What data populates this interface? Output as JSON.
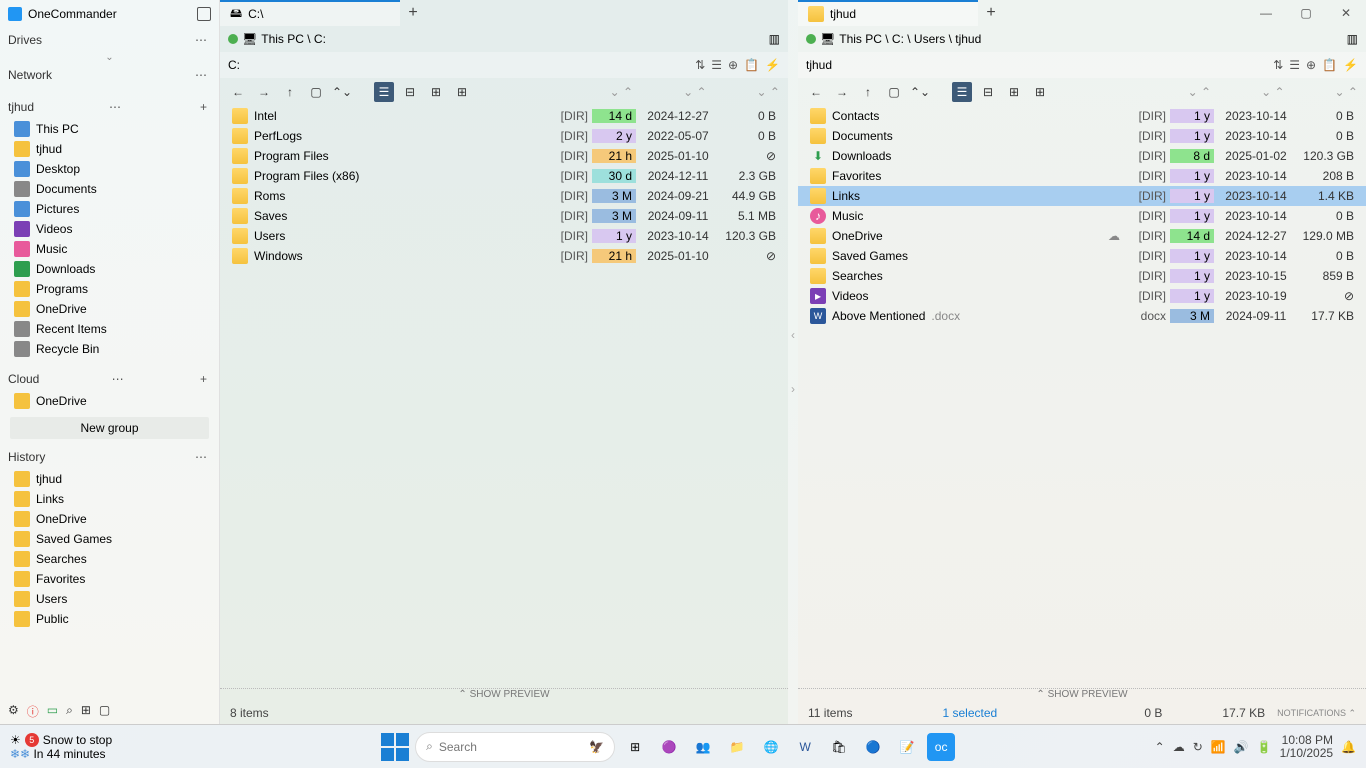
{
  "app": {
    "title": "OneCommander"
  },
  "sidebar": {
    "sections": {
      "drives": {
        "label": "Drives"
      },
      "network": {
        "label": "Network"
      },
      "user": {
        "label": "tjhud"
      },
      "cloud": {
        "label": "Cloud"
      },
      "history": {
        "label": "History"
      }
    },
    "userItems": [
      {
        "label": "This PC",
        "color": "#4a90d9"
      },
      {
        "label": "tjhud",
        "color": "#f5c23e"
      },
      {
        "label": "Desktop",
        "color": "#4a90d9"
      },
      {
        "label": "Documents",
        "color": "#888"
      },
      {
        "label": "Pictures",
        "color": "#4a90d9"
      },
      {
        "label": "Videos",
        "color": "#7b3fb5"
      },
      {
        "label": "Music",
        "color": "#e85a9b"
      },
      {
        "label": "Downloads",
        "color": "#2e9e4f"
      },
      {
        "label": "Programs",
        "color": "#f5c23e"
      },
      {
        "label": "OneDrive",
        "color": "#f5c23e"
      },
      {
        "label": "Recent Items",
        "color": "#888"
      },
      {
        "label": "Recycle Bin",
        "color": "#888"
      }
    ],
    "cloudItems": [
      {
        "label": "OneDrive"
      }
    ],
    "newGroup": "New group",
    "historyItems": [
      {
        "label": "tjhud"
      },
      {
        "label": "Links"
      },
      {
        "label": "OneDrive"
      },
      {
        "label": "Saved Games"
      },
      {
        "label": "Searches"
      },
      {
        "label": "Favorites"
      },
      {
        "label": "Users"
      },
      {
        "label": "Public"
      }
    ]
  },
  "left": {
    "tab": "C:\\",
    "breadcrumb": "This PC  \\ C:",
    "path": "C:",
    "files": [
      {
        "name": "Intel",
        "type": "[DIR]",
        "age": "14 d",
        "ageCls": "age-green",
        "date": "2024-12-27",
        "size": "0 B"
      },
      {
        "name": "PerfLogs",
        "type": "[DIR]",
        "age": "2 y",
        "ageCls": "age-violet",
        "date": "2022-05-07",
        "size": "0 B"
      },
      {
        "name": "Program Files",
        "type": "[DIR]",
        "age": "21 h",
        "ageCls": "age-orange",
        "date": "2025-01-10",
        "size": "⊘"
      },
      {
        "name": "Program Files (x86)",
        "type": "[DIR]",
        "age": "30 d",
        "ageCls": "age-teal",
        "date": "2024-12-11",
        "size": "2.3 GB"
      },
      {
        "name": "Roms",
        "type": "[DIR]",
        "age": "3 M",
        "ageCls": "age-blue",
        "date": "2024-09-21",
        "size": "44.9 GB"
      },
      {
        "name": "Saves",
        "type": "[DIR]",
        "age": "3 M",
        "ageCls": "age-blue",
        "date": "2024-09-11",
        "size": "5.1 MB"
      },
      {
        "name": "Users",
        "type": "[DIR]",
        "age": "1 y",
        "ageCls": "age-violet",
        "date": "2023-10-14",
        "size": "120.3 GB"
      },
      {
        "name": "Windows",
        "type": "[DIR]",
        "age": "21 h",
        "ageCls": "age-orange",
        "date": "2025-01-10",
        "size": "⊘"
      }
    ],
    "status": {
      "count": "8 items"
    },
    "preview": "⌃  SHOW PREVIEW"
  },
  "right": {
    "tab": "tjhud",
    "breadcrumb": "This PC  \\ C:  \\ Users  \\ tjhud",
    "path": "tjhud",
    "files": [
      {
        "name": "Contacts",
        "type": "[DIR]",
        "age": "1 y",
        "ageCls": "age-violet",
        "date": "2023-10-14",
        "size": "0 B",
        "icon": "folder"
      },
      {
        "name": "Documents",
        "type": "[DIR]",
        "age": "1 y",
        "ageCls": "age-violet",
        "date": "2023-10-14",
        "size": "0 B",
        "icon": "folder"
      },
      {
        "name": "Downloads",
        "type": "[DIR]",
        "age": "8 d",
        "ageCls": "age-green",
        "date": "2025-01-02",
        "size": "120.3 GB",
        "icon": "download"
      },
      {
        "name": "Favorites",
        "type": "[DIR]",
        "age": "1 y",
        "ageCls": "age-violet",
        "date": "2023-10-14",
        "size": "208 B",
        "icon": "folder"
      },
      {
        "name": "Links",
        "type": "[DIR]",
        "age": "1 y",
        "ageCls": "age-violet",
        "date": "2023-10-14",
        "size": "1.4 KB",
        "icon": "folder",
        "selected": true
      },
      {
        "name": "Music",
        "type": "[DIR]",
        "age": "1 y",
        "ageCls": "age-violet",
        "date": "2023-10-14",
        "size": "0 B",
        "icon": "music"
      },
      {
        "name": "OneDrive",
        "type": "[DIR]",
        "age": "14 d",
        "ageCls": "age-green",
        "date": "2024-12-27",
        "size": "129.0 MB",
        "icon": "folder",
        "cloud": true
      },
      {
        "name": "Saved Games",
        "type": "[DIR]",
        "age": "1 y",
        "ageCls": "age-violet",
        "date": "2023-10-14",
        "size": "0 B",
        "icon": "folder"
      },
      {
        "name": "Searches",
        "type": "[DIR]",
        "age": "1 y",
        "ageCls": "age-violet",
        "date": "2023-10-15",
        "size": "859 B",
        "icon": "folder"
      },
      {
        "name": "Videos",
        "type": "[DIR]",
        "age": "1 y",
        "ageCls": "age-violet",
        "date": "2023-10-19",
        "size": "⊘",
        "icon": "video"
      },
      {
        "name": "Above Mentioned",
        "ext": ".docx",
        "type": "docx",
        "age": "3 M",
        "ageCls": "age-blue",
        "date": "2024-09-11",
        "size": "17.7 KB",
        "icon": "docx"
      }
    ],
    "status": {
      "count": "11 items",
      "selected": "1 selected",
      "sizeA": "0 B",
      "sizeB": "17.7 KB",
      "notif": "NOTIFICATIONS  ⌃"
    },
    "preview": "⌃  SHOW PREVIEW"
  },
  "taskbar": {
    "weather": {
      "badge": "5",
      "line1": "Snow to stop",
      "line2": "In 44 minutes"
    },
    "search": "Search",
    "clock": {
      "time": "10:08 PM",
      "date": "1/10/2025"
    }
  }
}
